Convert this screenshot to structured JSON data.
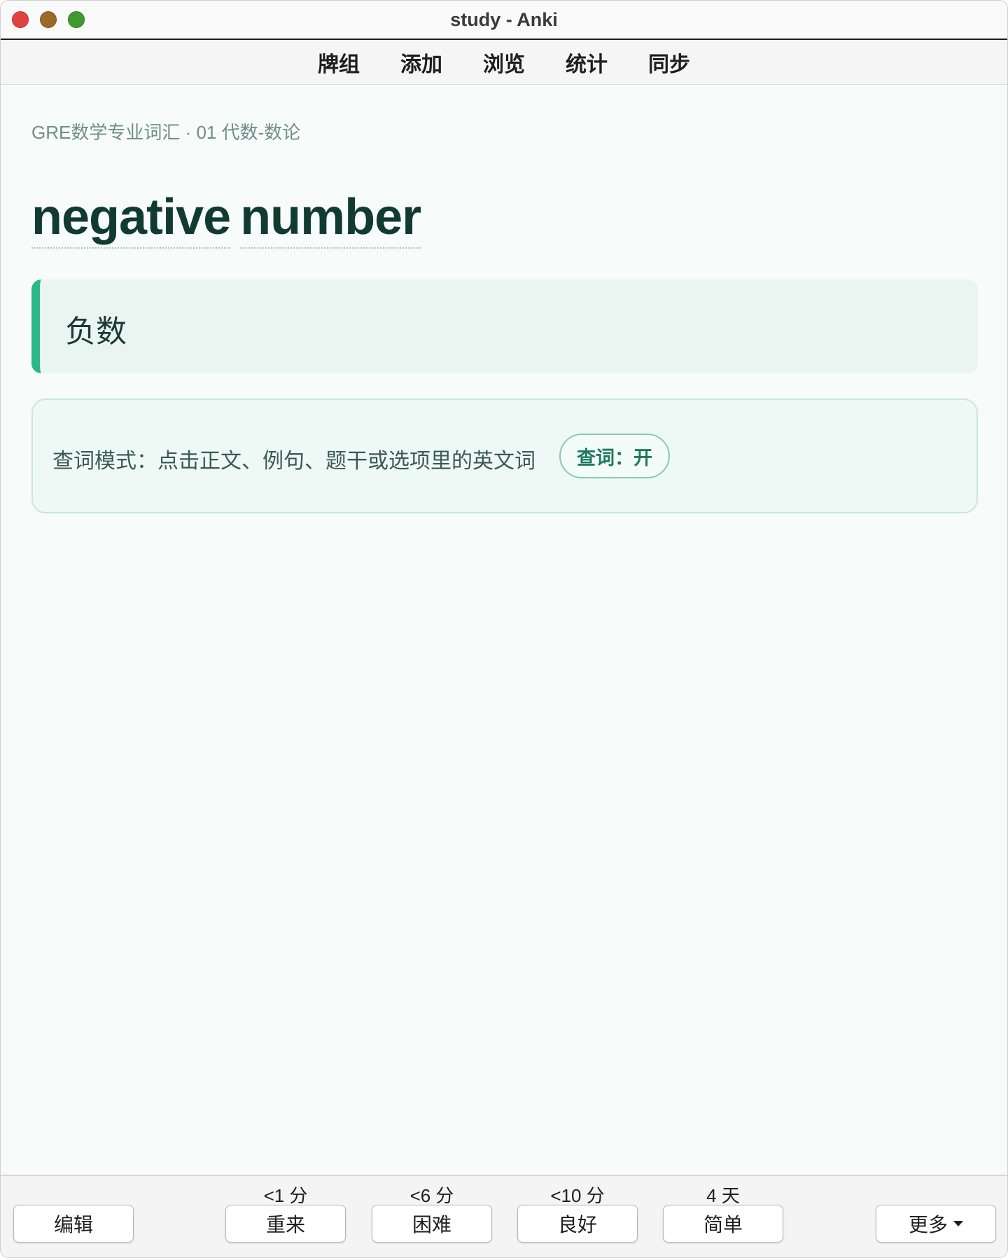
{
  "window": {
    "title": "study - Anki"
  },
  "nav": [
    "牌组",
    "添加",
    "浏览",
    "统计",
    "同步"
  ],
  "card": {
    "deck_path": "GRE数学专业词汇 · 01 代数-数论",
    "headword_parts": [
      "negative",
      "number"
    ],
    "meaning": "负数"
  },
  "lookup": {
    "hint": "查词模式：点击正文、例句、题干或选项里的英文词",
    "toggle_label": "查词：开"
  },
  "bottom": {
    "edit_label": "编辑",
    "answers": [
      {
        "interval": "<1 分",
        "label": "重来"
      },
      {
        "interval": "<6 分",
        "label": "困难"
      },
      {
        "interval": "<10 分",
        "label": "良好"
      },
      {
        "interval": "4 天",
        "label": "简单"
      }
    ],
    "more_label": "更多"
  },
  "colors": {
    "accent": "#2ab885",
    "headword": "#123b30",
    "toggle_text": "#1c7a5c"
  }
}
